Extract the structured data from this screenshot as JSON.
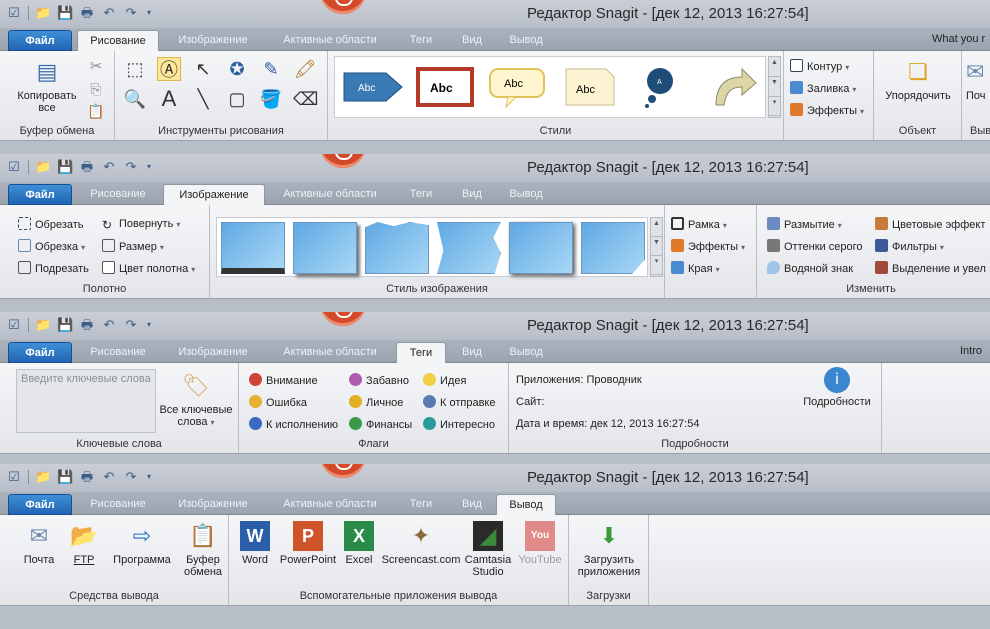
{
  "window_title": "Редактор Snagit - [дек 12, 2013 16:27:54]",
  "file_tab": "Файл",
  "tabs": [
    "Рисование",
    "Изображение",
    "Активные области",
    "Теги",
    "Вид",
    "Вывод"
  ],
  "tab_right_text": {
    "drawing": "What you r",
    "tags": "Intro"
  },
  "drawing": {
    "copy_all": "Копировать все",
    "clipboard_group": "Буфер обмена",
    "tools_group": "Инструменты рисования",
    "styles_group": "Стили",
    "style_labels": [
      "Abc",
      "Abc",
      "Abc",
      "Abc",
      "A"
    ],
    "outline": "Контур",
    "fill": "Заливка",
    "effects": "Эффекты",
    "arrange": "Упорядочить",
    "object_group": "Объект",
    "partial_button": "Поч",
    "partial_group": "Выв"
  },
  "image": {
    "crop": "Обрезать",
    "rotate": "Повернуть",
    "trim": "Обрезка",
    "resize": "Размер",
    "cut_out": "Подрезать",
    "canvas_color": "Цвет полотна",
    "canvas_group": "Полотно",
    "image_style_group": "Стиль изображения",
    "border": "Рамка",
    "effects": "Эффекты",
    "edges": "Края",
    "blur": "Размытие",
    "grayscale": "Оттенки серого",
    "watermark": "Водяной знак",
    "color_effects": "Цветовые эффект",
    "filters": "Фильтры",
    "spotlight": "Выделение и увел",
    "modify_group": "Изменить"
  },
  "tags": {
    "keywords_placeholder": "Введите ключевые слова",
    "all_keywords": "Все ключевые слова",
    "keywords_group": "Ключевые слова",
    "flags": [
      "Внимание",
      "Ошибка",
      "К исполнению",
      "Забавно",
      "Личное",
      "Финансы",
      "Идея",
      "К отправке",
      "Интересно"
    ],
    "flags_group": "Флаги",
    "app_label": "Приложения:",
    "app_value": "Проводник",
    "site_label": "Сайт:",
    "datetime_label": "Дата и время:",
    "datetime_value": "дек 12, 2013 16:27:54",
    "details_button": "Подробности",
    "details_group": "Подробности"
  },
  "output": {
    "email": "Почта",
    "ftp": "FTP",
    "program": "Программа",
    "clipboard": "Буфер обмена",
    "output_group": "Средства вывода",
    "word": "Word",
    "powerpoint": "PowerPoint",
    "excel": "Excel",
    "screencast": "Screencast.com",
    "camtasia": "Camtasia Studio",
    "youtube": "YouTube",
    "helper_group": "Вспомогательные приложения вывода",
    "download": "Загрузить приложения",
    "downloads_group": "Загрузки"
  },
  "colors": {
    "file_tab": "#2a72c2",
    "ribbon_bg": "#eceef1",
    "tab_bar": "#a3acb7",
    "logo": "#d24a2a"
  }
}
